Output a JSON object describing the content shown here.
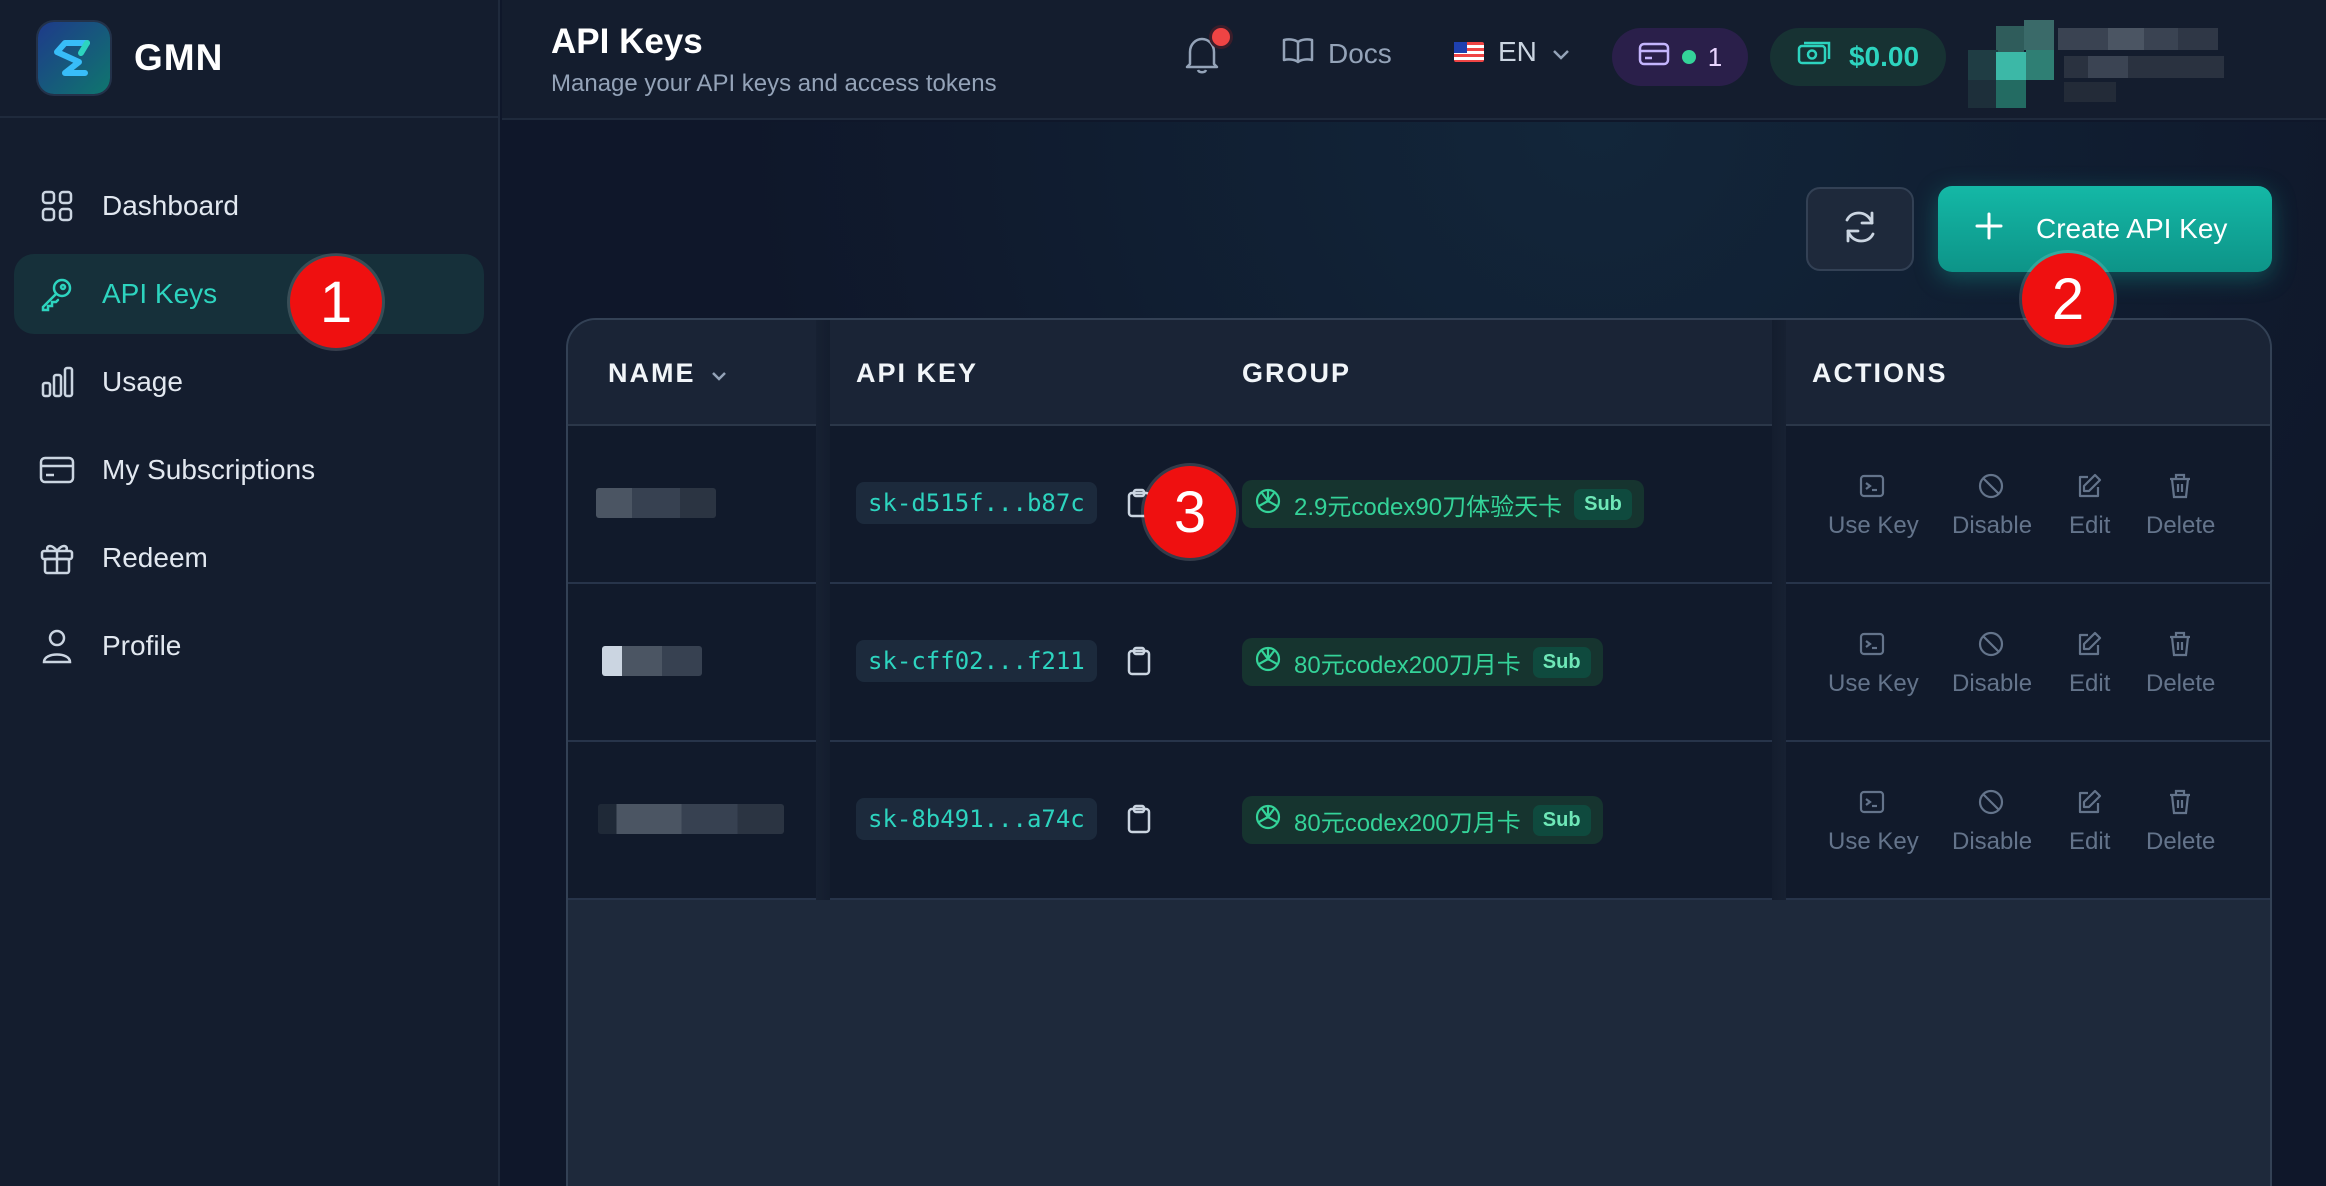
{
  "brand": {
    "name": "GMN",
    "logo_icon": "s-logo-icon"
  },
  "sidebar": {
    "items": [
      {
        "label": "Dashboard",
        "icon": "grid-icon",
        "active": false
      },
      {
        "label": "API Keys",
        "icon": "key-icon",
        "active": true
      },
      {
        "label": "Usage",
        "icon": "bar-chart-icon",
        "active": false
      },
      {
        "label": "My Subscriptions",
        "icon": "credit-card-icon",
        "active": false
      },
      {
        "label": "Redeem",
        "icon": "gift-icon",
        "active": false
      },
      {
        "label": "Profile",
        "icon": "user-icon",
        "active": false
      }
    ]
  },
  "header": {
    "title": "API Keys",
    "subtitle": "Manage your API keys and access tokens",
    "docs_label": "Docs",
    "language": "EN",
    "plan_count": "1",
    "balance": "$0.00"
  },
  "toolbar": {
    "create_label": "Create API Key"
  },
  "table": {
    "columns": {
      "name": "NAME",
      "api_key": "API KEY",
      "group": "GROUP",
      "actions": "ACTIONS"
    },
    "rows": [
      {
        "api_key": "sk-d515f...b87c",
        "group": "2.9元codex90刀体验天卡",
        "badge": "Sub"
      },
      {
        "api_key": "sk-cff02...f211",
        "group": "80元codex200刀月卡",
        "badge": "Sub"
      },
      {
        "api_key": "sk-8b491...a74c",
        "group": "80元codex200刀月卡",
        "badge": "Sub"
      }
    ],
    "actions": {
      "use_key": "Use Key",
      "disable": "Disable",
      "edit": "Edit",
      "delete": "Delete"
    }
  },
  "markers": [
    "1",
    "2",
    "3"
  ],
  "colors": {
    "accent": "#14b8a6",
    "background": "#0f172a",
    "marker": "#ef1010"
  }
}
